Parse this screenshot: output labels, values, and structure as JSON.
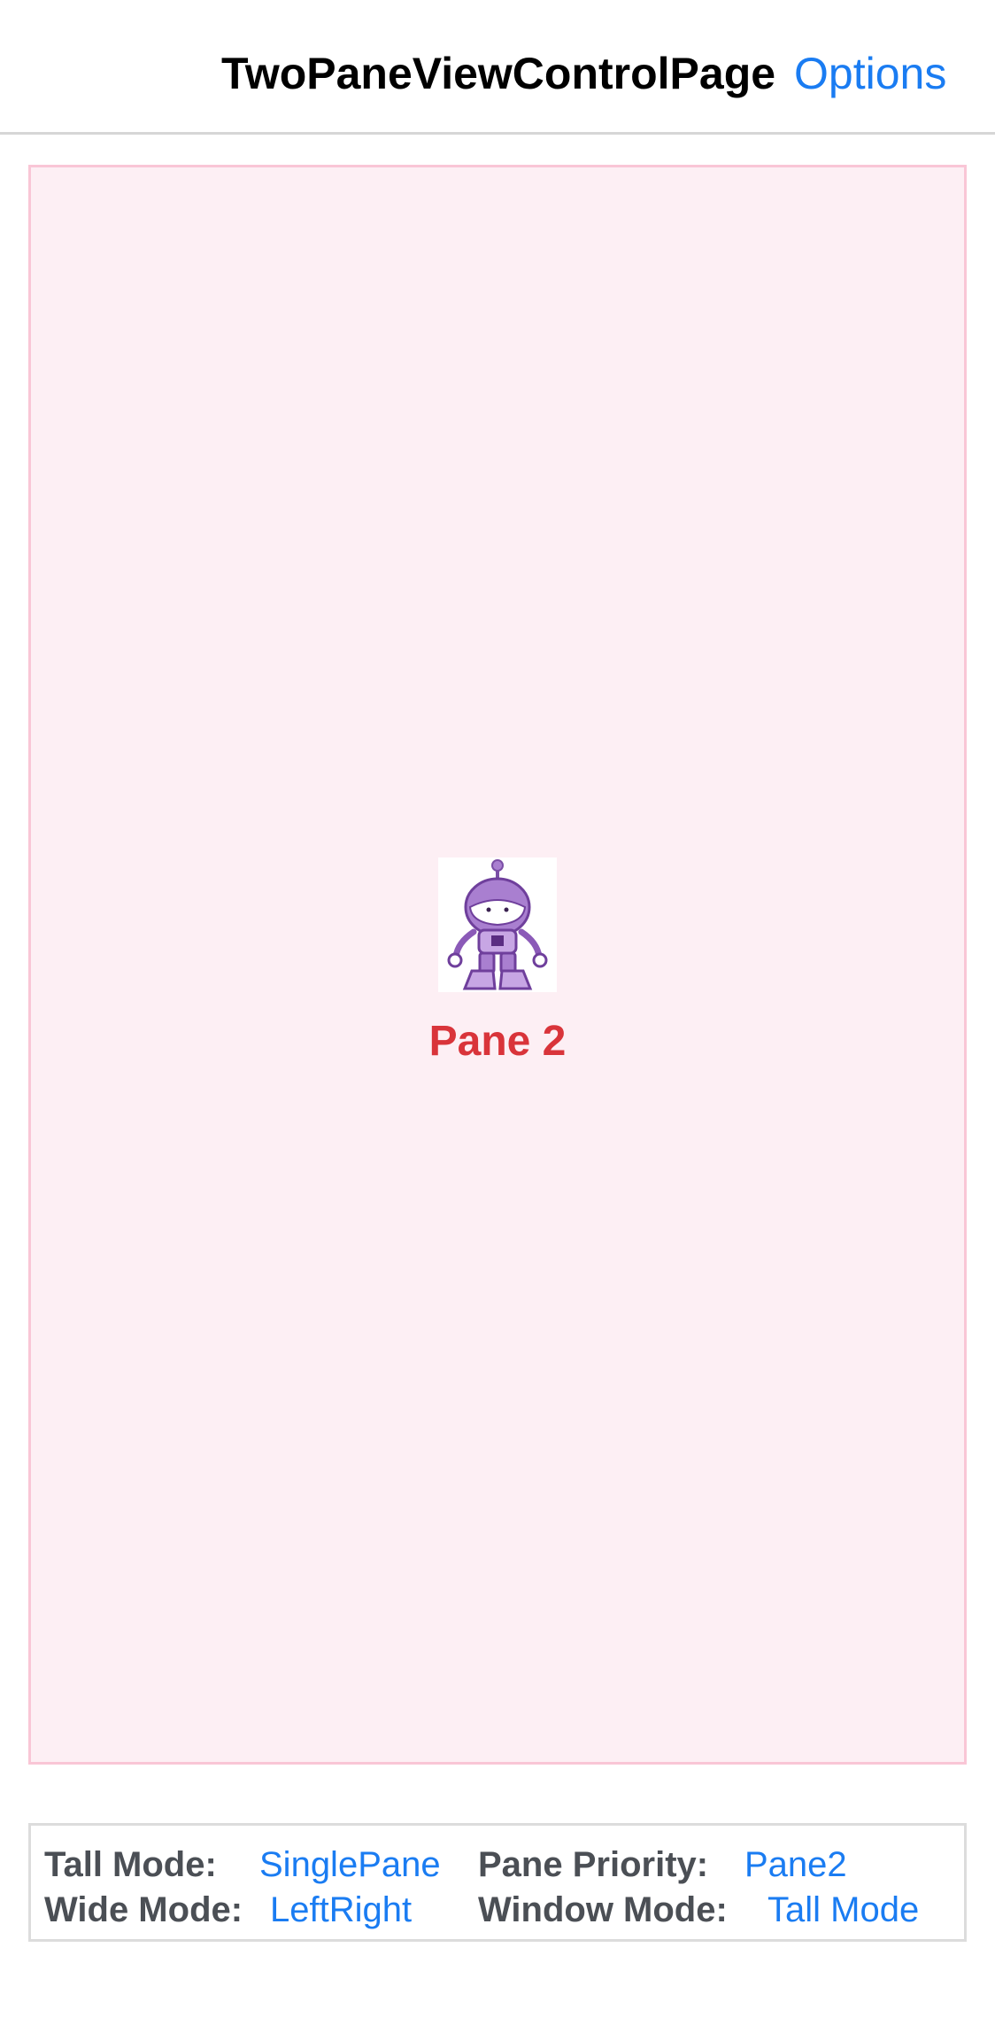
{
  "navbar": {
    "title": "TwoPaneViewControlPage",
    "options_label": "Options"
  },
  "pane": {
    "label": "Pane 2",
    "image": "dotnet-bot-robot"
  },
  "settings": {
    "tall_mode_label": "Tall Mode:",
    "tall_mode_value": "SinglePane",
    "wide_mode_label": "Wide Mode:",
    "wide_mode_value": "LeftRight",
    "pane_priority_label": "Pane Priority:",
    "pane_priority_value": "Pane2",
    "window_mode_label": "Window Mode:",
    "window_mode_value": "Tall Mode"
  },
  "colors": {
    "accent": "#1a7cf2",
    "pane_background": "#fdeff4",
    "pane_border": "#f9c6d6",
    "pane_label": "#d9343a"
  }
}
